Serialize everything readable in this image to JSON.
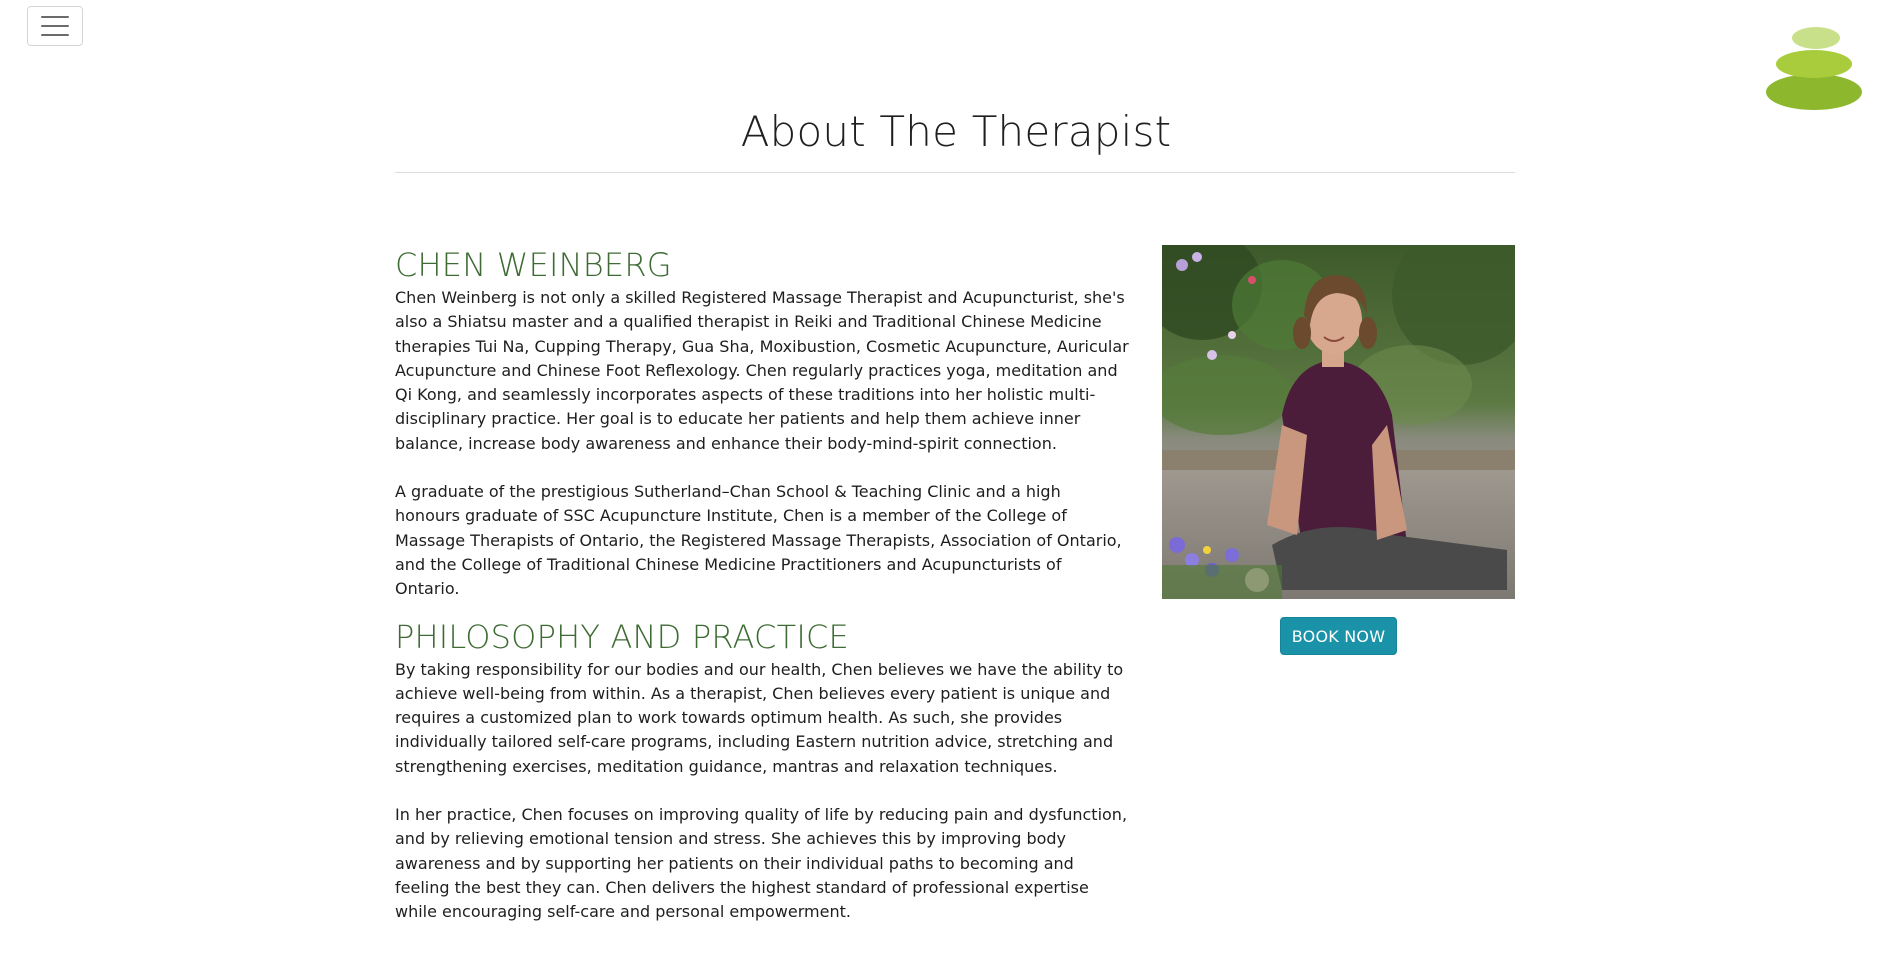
{
  "header": {
    "menu_icon": "hamburger-menu-icon",
    "logo_icon": "stacked-stones-logo"
  },
  "page": {
    "title": "About The Therapist"
  },
  "therapist": {
    "name_heading": "CHEN WEINBERG",
    "bio": [
      "Chen Weinberg is not only a skilled Registered Massage Therapist and Acupuncturist, she's also a Shiatsu master and a qualified therapist in Reiki and Traditional Chinese Medicine therapies Tui Na, Cupping Therapy, Gua Sha, Moxibustion, Cosmetic Acupuncture, Auricular Acupuncture and Chinese Foot Reflexology. Chen regularly practices yoga, meditation and Qi Kong, and seamlessly incorporates aspects of these traditions into her holistic multi-disciplinary practice. Her goal is to educate her patients and help them achieve inner balance, increase body awareness and enhance their body-mind-spirit connection.",
      "A graduate of the prestigious Sutherland–Chan School & Teaching Clinic and a high honours graduate of SSC Acupuncture Institute, Chen is a member of the College of Massage Therapists of Ontario, the Registered Massage Therapists, Association of Ontario, and the College of Traditional Chinese Medicine Practitioners and Acupuncturists of Ontario."
    ],
    "philosophy_heading": "PHILOSOPHY AND PRACTICE",
    "philosophy": [
      "By taking responsibility for our bodies and our health, Chen believes we have the ability to achieve well-being from within. As a therapist, Chen believes every patient is unique and requires a customized plan to work towards optimum health. As such, she provides individually tailored self-care programs, including Eastern nutrition advice, stretching and strengthening exercises, meditation guidance, mantras and relaxation techniques.",
      "In her practice, Chen focuses on improving quality of life by reducing pain and dysfunction, and by relieving emotional tension and stress. She achieves this by improving body awareness and by supporting her patients on their individual paths to becoming and feeling the best they can. Chen delivers the highest standard of professional expertise while encouraging self-care and personal empowerment."
    ],
    "photo_icon": "therapist-portrait-photo"
  },
  "actions": {
    "book_label": "BOOK NOW"
  },
  "colors": {
    "heading_green": "#3e6b33",
    "button_teal": "#1a93a8",
    "logo_light": "#c8e08a",
    "logo_mid": "#a8cc3c",
    "logo_dark": "#8db82e"
  }
}
